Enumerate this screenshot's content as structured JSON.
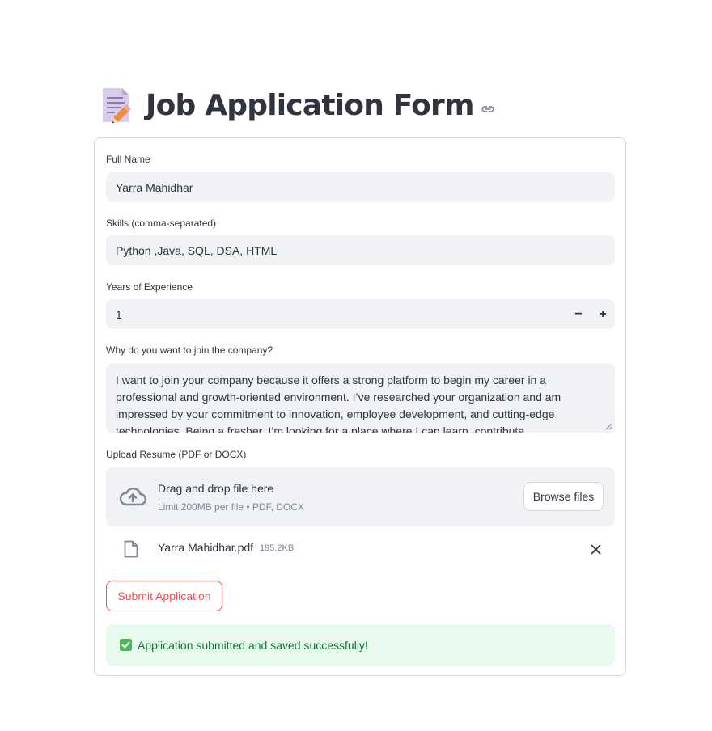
{
  "page": {
    "title": "Job Application Form",
    "title_icon": "memo-icon",
    "anchor_icon": "link-icon"
  },
  "form": {
    "full_name": {
      "label": "Full Name",
      "value": "Yarra Mahidhar"
    },
    "skills": {
      "label": "Skills (comma-separated)",
      "value": "Python ,Java, SQL, DSA, HTML"
    },
    "experience": {
      "label": "Years of Experience",
      "value": "1",
      "decrement": "−",
      "increment": "+"
    },
    "motivation": {
      "label": "Why do you want to join the company?",
      "value": "I want to join your company because it offers a strong platform to begin my career in a professional and growth-oriented environment. I’ve researched your organization and am impressed by your commitment to innovation, employee development, and cutting-edge technologies. Being a fresher, I’m looking for a place where I can learn, contribute"
    },
    "resume": {
      "label": "Upload Resume (PDF or DOCX)",
      "drop_title": "Drag and drop file here",
      "drop_hint": "Limit 200MB per file • PDF, DOCX",
      "browse_label": "Browse files",
      "uploaded_file": {
        "name": "Yarra Mahidhar.pdf",
        "size": "195.2KB"
      }
    },
    "submit_label": "Submit Application"
  },
  "status": {
    "message": "Application submitted and saved successfully!",
    "color": "#177233"
  },
  "colors": {
    "accent": "#ff4b4b",
    "input_bg": "#f0f2f6",
    "success_bg": "#e8f9ee",
    "text": "#31333f"
  }
}
